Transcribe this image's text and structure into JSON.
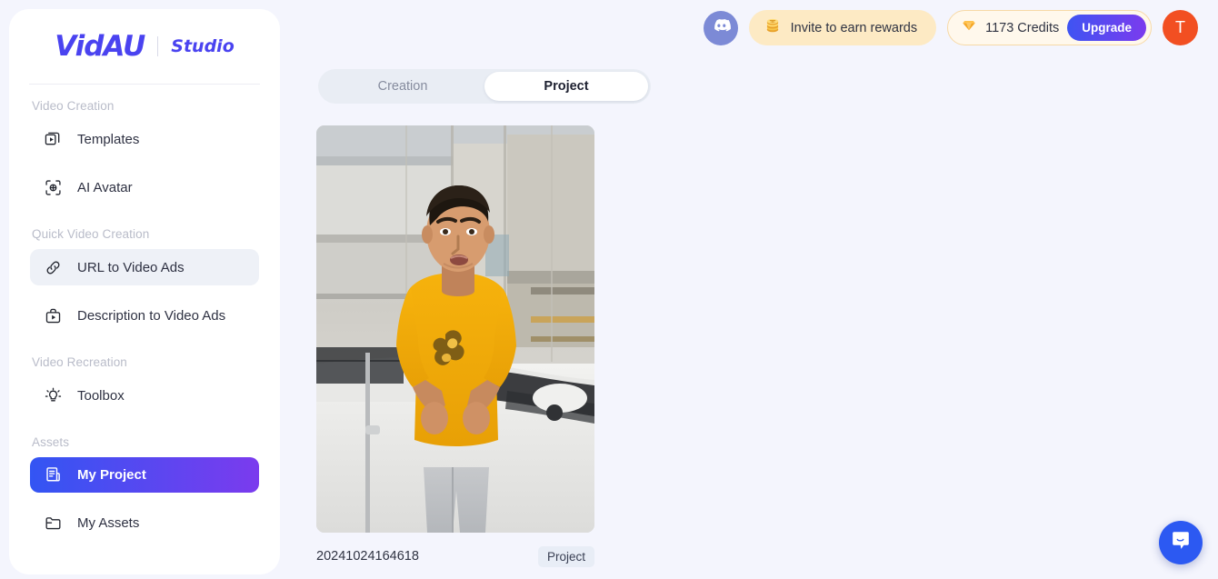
{
  "brand": {
    "logo": "VidAU",
    "product": "Studio"
  },
  "sidebar": {
    "sections": [
      {
        "title": "Video Creation"
      },
      {
        "title": "Quick Video Creation"
      },
      {
        "title": "Video Recreation"
      },
      {
        "title": "Assets"
      }
    ],
    "items": [
      {
        "label": "Templates",
        "icon": "templates-icon",
        "state": "default"
      },
      {
        "label": "AI Avatar",
        "icon": "ai-avatar-icon",
        "state": "default"
      },
      {
        "label": "URL to Video Ads",
        "icon": "link-icon",
        "state": "hover"
      },
      {
        "label": "Description to Video Ads",
        "icon": "briefcase-play-icon",
        "state": "default"
      },
      {
        "label": "Toolbox",
        "icon": "lightbulb-icon",
        "state": "default"
      },
      {
        "label": "My Project",
        "icon": "document-icon",
        "state": "active"
      },
      {
        "label": "My Assets",
        "icon": "folder-icon",
        "state": "default"
      }
    ]
  },
  "header": {
    "discord_icon": "discord-icon",
    "invite": {
      "label": "Invite to earn rewards",
      "icon": "coins-icon"
    },
    "credits": {
      "label": "1173 Credits",
      "value": 1173,
      "icon": "gem-icon"
    },
    "upgrade_label": "Upgrade",
    "avatar_initial": "T"
  },
  "main": {
    "tabs": [
      {
        "label": "Creation",
        "selected": false
      },
      {
        "label": "Project",
        "selected": true
      }
    ],
    "project": {
      "name": "20241024164618",
      "badge": "Project",
      "thumbnail_alt": "person-in-yellow-shirt-video-thumbnail"
    }
  },
  "chat": {
    "icon": "chat-bubble-icon"
  },
  "colors": {
    "page_background": "#f4f5fd",
    "brand_purple": "#4a43f0",
    "active_gradient_start": "#3355f3",
    "active_gradient_end": "#7b3bee",
    "invite_pill": "#fdeac4",
    "credits_pill": "#fff8ec",
    "avatar": "#f24f22",
    "chat_blue": "#2c59f2",
    "discord_blue": "#7c8ad6"
  }
}
